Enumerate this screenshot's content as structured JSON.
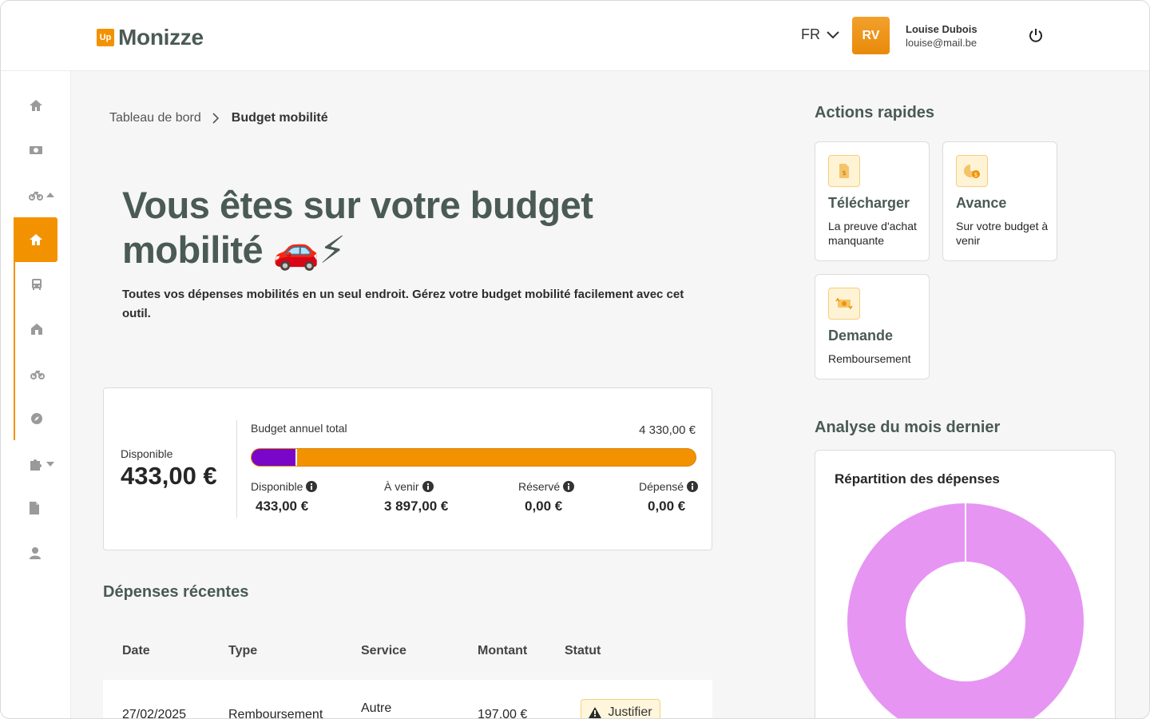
{
  "header": {
    "logo_badge": "Up",
    "logo_text": "Monizze",
    "language": "FR",
    "avatar_initials": "RV",
    "user_name": "Louise Dubois",
    "user_email": "louise@mail.be"
  },
  "sidebar": {
    "items": [
      "home-icon",
      "money-icon",
      "bike-icon",
      "home-icon",
      "bus-icon",
      "house-icon",
      "bike-icon",
      "compass-icon",
      "puzzle-icon",
      "document-icon",
      "user-icon"
    ]
  },
  "breadcrumb": {
    "parent": "Tableau de bord",
    "current": "Budget mobilité"
  },
  "hero": {
    "title": "Vous êtes sur votre budget mobilité 🚗⚡",
    "subtitle": "Toutes vos dépenses mobilités en un seul endroit. Gérez votre budget mobilité facilement avec cet outil."
  },
  "budget": {
    "available_label": "Disponible",
    "available_value": "433,00 €",
    "total_label": "Budget annuel total",
    "total_value": "4 330,00 €",
    "available_fraction": 0.1,
    "metrics": [
      {
        "label": "Disponible",
        "value": "433,00 €"
      },
      {
        "label": "À venir",
        "value": "3 897,00 €"
      },
      {
        "label": "Réservé",
        "value": "0,00 €"
      },
      {
        "label": "Dépensé",
        "value": "0,00 €"
      }
    ],
    "colors": {
      "available": "#7a06c9",
      "upcoming": "#f39200"
    }
  },
  "recent": {
    "title": "Dépenses récentes",
    "columns": [
      "Date",
      "Type",
      "Service",
      "Montant",
      "Statut"
    ],
    "rows": [
      {
        "date": "27/02/2025",
        "type": "Remboursement",
        "service": "Autre",
        "amount": "197,00 €",
        "status": "Justifier"
      }
    ]
  },
  "quick_actions": {
    "title": "Actions rapides",
    "items": [
      {
        "title": "Télécharger",
        "text": "La preuve d'achat manquante",
        "icon": "document-dollar-icon"
      },
      {
        "title": "Avance",
        "text": "Sur votre budget à venir",
        "icon": "pie-coin-icon"
      },
      {
        "title": "Demande",
        "text": "Remboursement",
        "icon": "money-exchange-icon"
      }
    ]
  },
  "analysis": {
    "title": "Analyse du mois dernier",
    "card_title": "Répartition des dépenses",
    "colors": {
      "slice": "#e695f3"
    }
  },
  "chart_data": {
    "type": "pie",
    "title": "Répartition des dépenses",
    "values": [
      100
    ]
  }
}
